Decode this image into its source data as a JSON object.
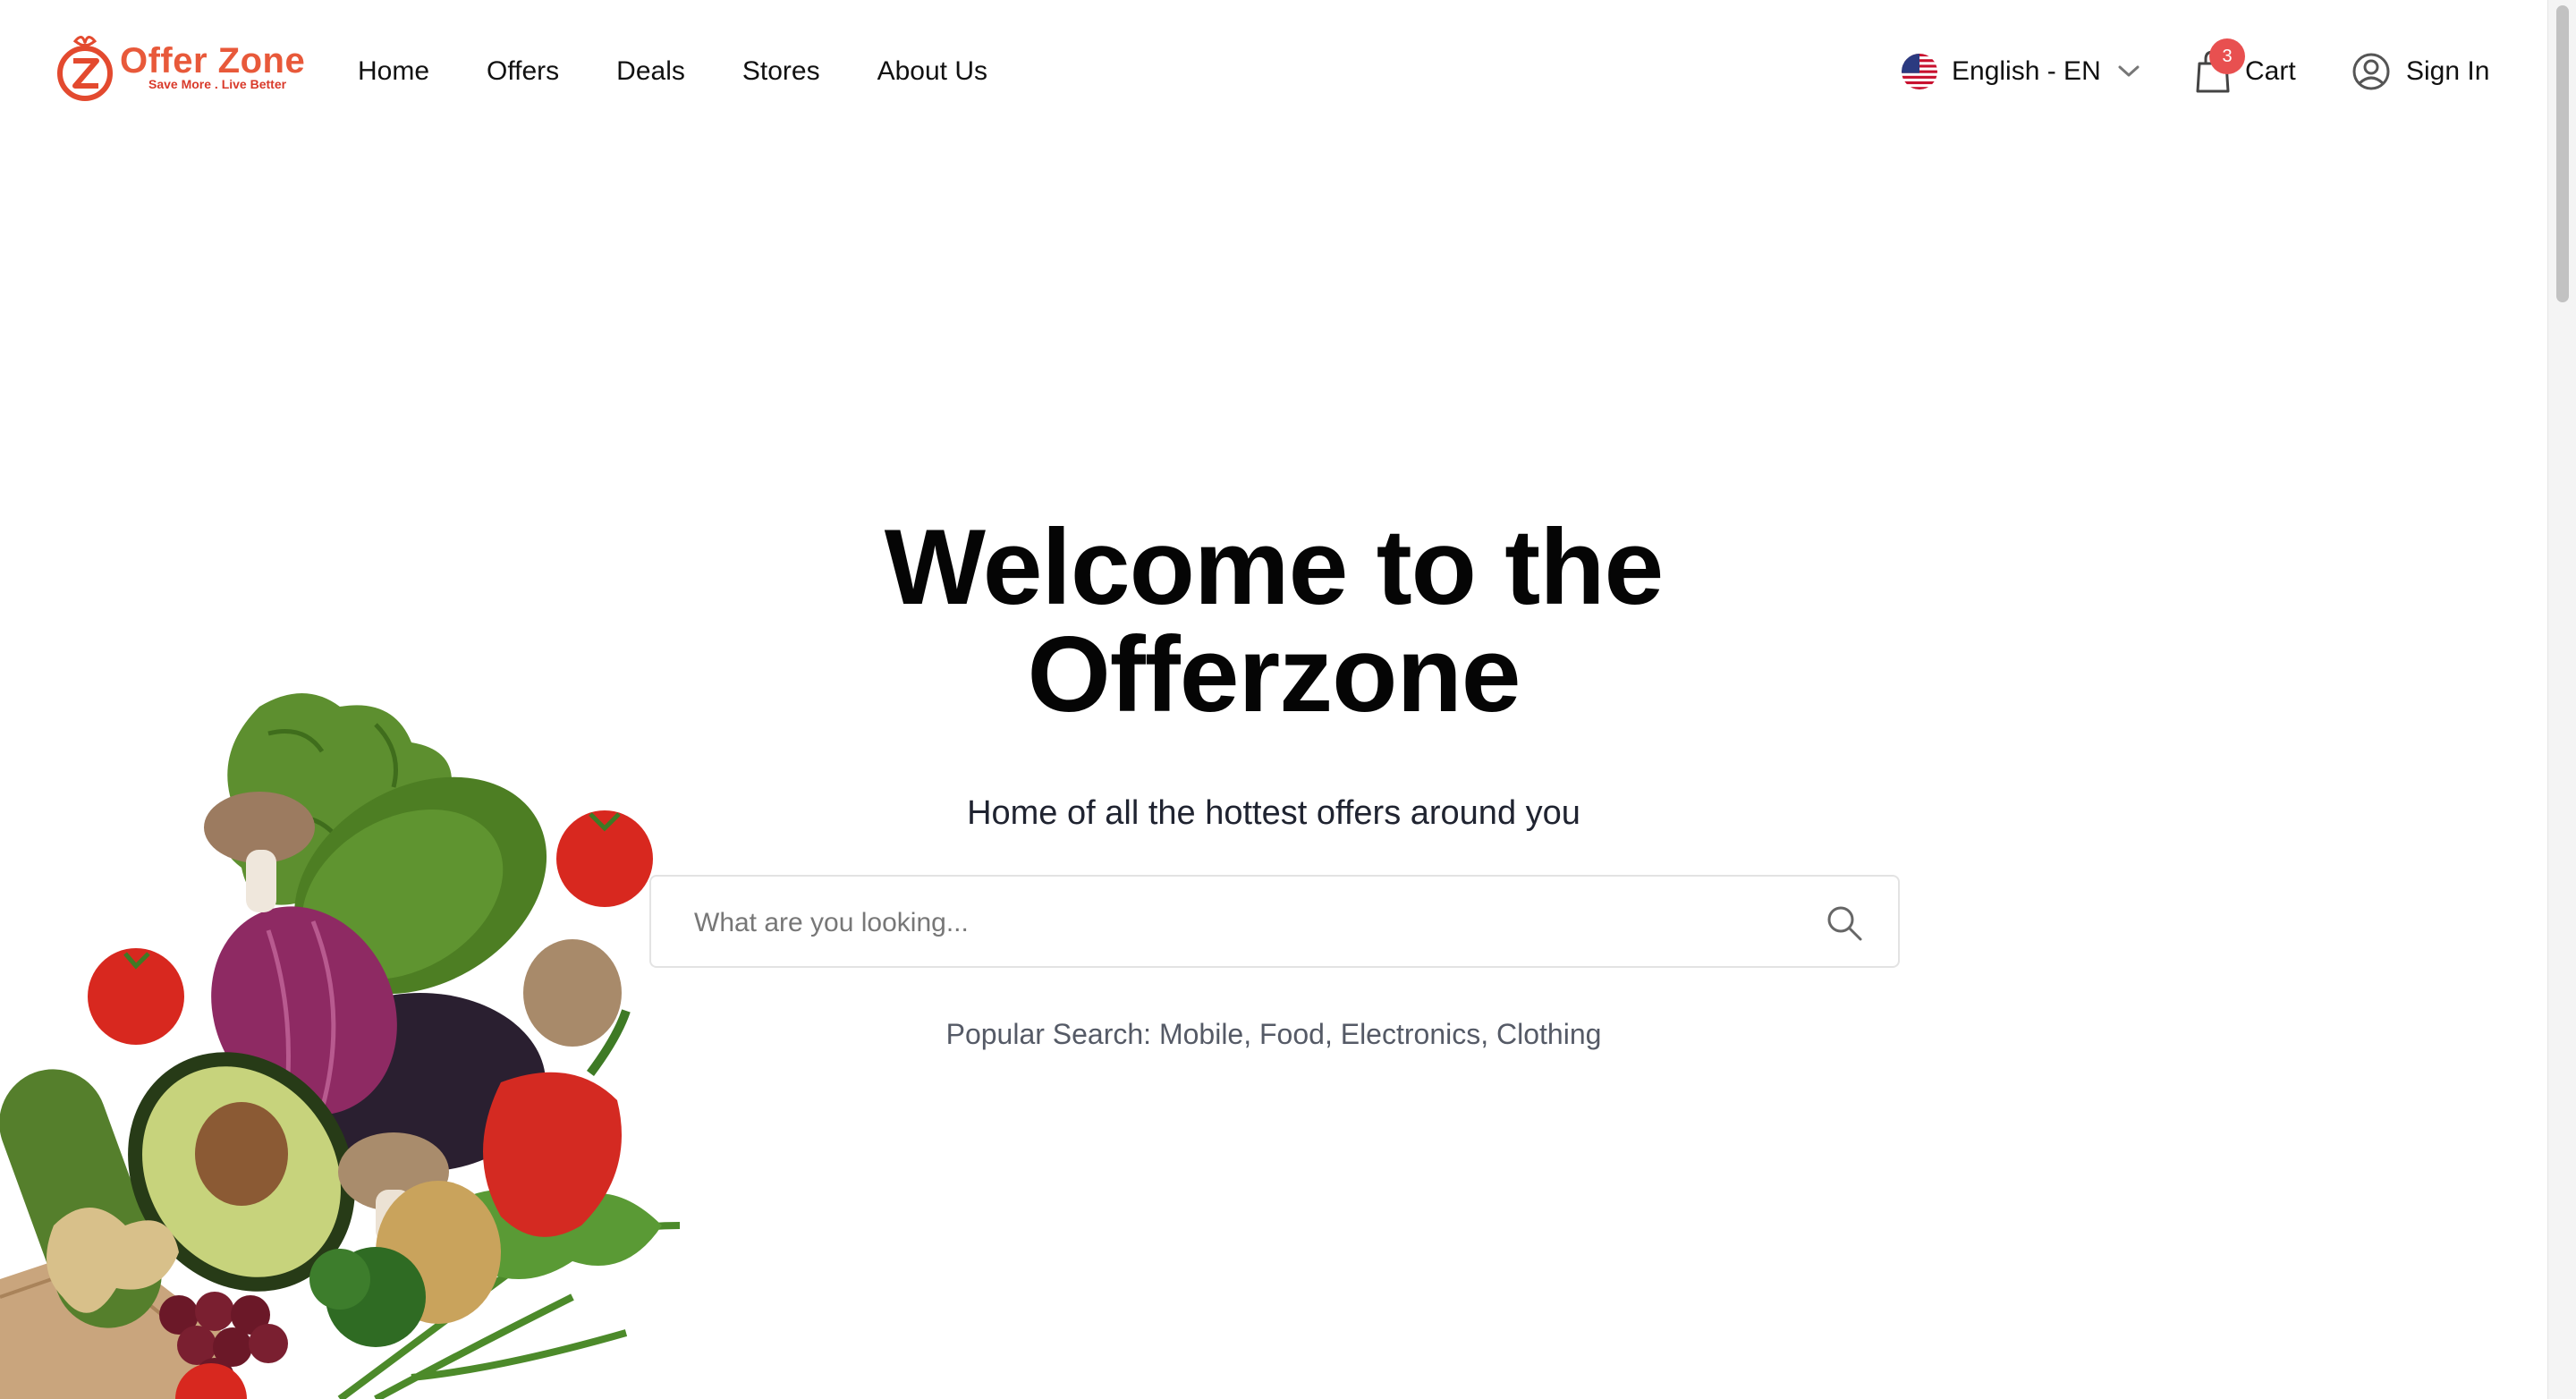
{
  "header": {
    "logo": {
      "name": "Offer Zone",
      "tagline": "Save More . Live Better"
    },
    "nav": [
      {
        "label": "Home"
      },
      {
        "label": "Offers"
      },
      {
        "label": "Deals"
      },
      {
        "label": "Stores"
      },
      {
        "label": "About Us"
      }
    ],
    "language": {
      "label": "English - EN",
      "flag_icon": "us-flag-icon"
    },
    "cart": {
      "label": "Cart",
      "count": "3"
    },
    "signin": {
      "label": "Sign In"
    }
  },
  "hero": {
    "title_line1": "Welcome to the",
    "title_line2": "Offerzone",
    "subtitle": "Home of all the hottest offers around you",
    "search": {
      "placeholder": "What are you looking...",
      "value": ""
    },
    "popular": {
      "label": "Popular Search:",
      "terms": [
        "Mobile",
        "Food",
        "Electronics",
        "Clothing"
      ]
    }
  },
  "colors": {
    "brand": "#e8593a",
    "badge": "#e85050",
    "text": "#111111",
    "muted": "#555a66"
  }
}
